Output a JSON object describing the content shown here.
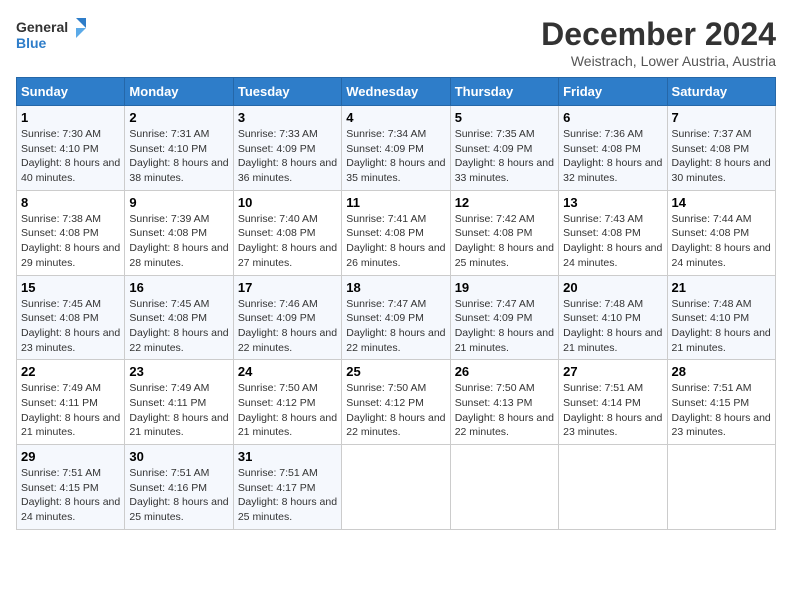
{
  "logo": {
    "line1": "General",
    "line2": "Blue"
  },
  "title": "December 2024",
  "subtitle": "Weistrach, Lower Austria, Austria",
  "days_of_week": [
    "Sunday",
    "Monday",
    "Tuesday",
    "Wednesday",
    "Thursday",
    "Friday",
    "Saturday"
  ],
  "weeks": [
    [
      {
        "day": 1,
        "sunrise": "Sunrise: 7:30 AM",
        "sunset": "Sunset: 4:10 PM",
        "daylight": "Daylight: 8 hours and 40 minutes."
      },
      {
        "day": 2,
        "sunrise": "Sunrise: 7:31 AM",
        "sunset": "Sunset: 4:10 PM",
        "daylight": "Daylight: 8 hours and 38 minutes."
      },
      {
        "day": 3,
        "sunrise": "Sunrise: 7:33 AM",
        "sunset": "Sunset: 4:09 PM",
        "daylight": "Daylight: 8 hours and 36 minutes."
      },
      {
        "day": 4,
        "sunrise": "Sunrise: 7:34 AM",
        "sunset": "Sunset: 4:09 PM",
        "daylight": "Daylight: 8 hours and 35 minutes."
      },
      {
        "day": 5,
        "sunrise": "Sunrise: 7:35 AM",
        "sunset": "Sunset: 4:09 PM",
        "daylight": "Daylight: 8 hours and 33 minutes."
      },
      {
        "day": 6,
        "sunrise": "Sunrise: 7:36 AM",
        "sunset": "Sunset: 4:08 PM",
        "daylight": "Daylight: 8 hours and 32 minutes."
      },
      {
        "day": 7,
        "sunrise": "Sunrise: 7:37 AM",
        "sunset": "Sunset: 4:08 PM",
        "daylight": "Daylight: 8 hours and 30 minutes."
      }
    ],
    [
      {
        "day": 8,
        "sunrise": "Sunrise: 7:38 AM",
        "sunset": "Sunset: 4:08 PM",
        "daylight": "Daylight: 8 hours and 29 minutes."
      },
      {
        "day": 9,
        "sunrise": "Sunrise: 7:39 AM",
        "sunset": "Sunset: 4:08 PM",
        "daylight": "Daylight: 8 hours and 28 minutes."
      },
      {
        "day": 10,
        "sunrise": "Sunrise: 7:40 AM",
        "sunset": "Sunset: 4:08 PM",
        "daylight": "Daylight: 8 hours and 27 minutes."
      },
      {
        "day": 11,
        "sunrise": "Sunrise: 7:41 AM",
        "sunset": "Sunset: 4:08 PM",
        "daylight": "Daylight: 8 hours and 26 minutes."
      },
      {
        "day": 12,
        "sunrise": "Sunrise: 7:42 AM",
        "sunset": "Sunset: 4:08 PM",
        "daylight": "Daylight: 8 hours and 25 minutes."
      },
      {
        "day": 13,
        "sunrise": "Sunrise: 7:43 AM",
        "sunset": "Sunset: 4:08 PM",
        "daylight": "Daylight: 8 hours and 24 minutes."
      },
      {
        "day": 14,
        "sunrise": "Sunrise: 7:44 AM",
        "sunset": "Sunset: 4:08 PM",
        "daylight": "Daylight: 8 hours and 24 minutes."
      }
    ],
    [
      {
        "day": 15,
        "sunrise": "Sunrise: 7:45 AM",
        "sunset": "Sunset: 4:08 PM",
        "daylight": "Daylight: 8 hours and 23 minutes."
      },
      {
        "day": 16,
        "sunrise": "Sunrise: 7:45 AM",
        "sunset": "Sunset: 4:08 PM",
        "daylight": "Daylight: 8 hours and 22 minutes."
      },
      {
        "day": 17,
        "sunrise": "Sunrise: 7:46 AM",
        "sunset": "Sunset: 4:09 PM",
        "daylight": "Daylight: 8 hours and 22 minutes."
      },
      {
        "day": 18,
        "sunrise": "Sunrise: 7:47 AM",
        "sunset": "Sunset: 4:09 PM",
        "daylight": "Daylight: 8 hours and 22 minutes."
      },
      {
        "day": 19,
        "sunrise": "Sunrise: 7:47 AM",
        "sunset": "Sunset: 4:09 PM",
        "daylight": "Daylight: 8 hours and 21 minutes."
      },
      {
        "day": 20,
        "sunrise": "Sunrise: 7:48 AM",
        "sunset": "Sunset: 4:10 PM",
        "daylight": "Daylight: 8 hours and 21 minutes."
      },
      {
        "day": 21,
        "sunrise": "Sunrise: 7:48 AM",
        "sunset": "Sunset: 4:10 PM",
        "daylight": "Daylight: 8 hours and 21 minutes."
      }
    ],
    [
      {
        "day": 22,
        "sunrise": "Sunrise: 7:49 AM",
        "sunset": "Sunset: 4:11 PM",
        "daylight": "Daylight: 8 hours and 21 minutes."
      },
      {
        "day": 23,
        "sunrise": "Sunrise: 7:49 AM",
        "sunset": "Sunset: 4:11 PM",
        "daylight": "Daylight: 8 hours and 21 minutes."
      },
      {
        "day": 24,
        "sunrise": "Sunrise: 7:50 AM",
        "sunset": "Sunset: 4:12 PM",
        "daylight": "Daylight: 8 hours and 21 minutes."
      },
      {
        "day": 25,
        "sunrise": "Sunrise: 7:50 AM",
        "sunset": "Sunset: 4:12 PM",
        "daylight": "Daylight: 8 hours and 22 minutes."
      },
      {
        "day": 26,
        "sunrise": "Sunrise: 7:50 AM",
        "sunset": "Sunset: 4:13 PM",
        "daylight": "Daylight: 8 hours and 22 minutes."
      },
      {
        "day": 27,
        "sunrise": "Sunrise: 7:51 AM",
        "sunset": "Sunset: 4:14 PM",
        "daylight": "Daylight: 8 hours and 23 minutes."
      },
      {
        "day": 28,
        "sunrise": "Sunrise: 7:51 AM",
        "sunset": "Sunset: 4:15 PM",
        "daylight": "Daylight: 8 hours and 23 minutes."
      }
    ],
    [
      {
        "day": 29,
        "sunrise": "Sunrise: 7:51 AM",
        "sunset": "Sunset: 4:15 PM",
        "daylight": "Daylight: 8 hours and 24 minutes."
      },
      {
        "day": 30,
        "sunrise": "Sunrise: 7:51 AM",
        "sunset": "Sunset: 4:16 PM",
        "daylight": "Daylight: 8 hours and 25 minutes."
      },
      {
        "day": 31,
        "sunrise": "Sunrise: 7:51 AM",
        "sunset": "Sunset: 4:17 PM",
        "daylight": "Daylight: 8 hours and 25 minutes."
      },
      null,
      null,
      null,
      null
    ]
  ]
}
